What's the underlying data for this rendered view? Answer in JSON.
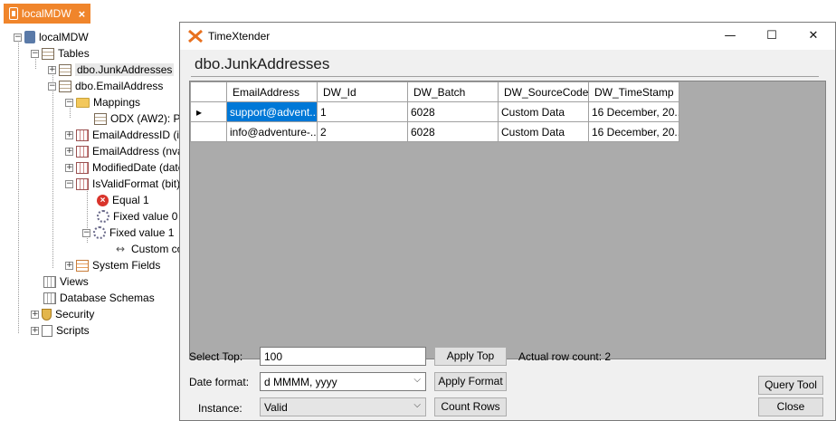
{
  "doc_tab": {
    "label": "localMDW"
  },
  "tree": {
    "root": "localMDW",
    "tables": "Tables",
    "junk": "dbo.JunkAddresses",
    "email": "dbo.EmailAddress",
    "mappings": "Mappings",
    "odx": "ODX (AW2): Pe",
    "f_id": "EmailAddressID (int",
    "f_email": "EmailAddress (nvar",
    "f_mod": "ModifiedDate (datet",
    "f_valid": "IsValidFormat (bit)",
    "equal": "Equal 1",
    "fixed0": "Fixed value 0",
    "fixed1": "Fixed value 1",
    "custom": "Custom cor",
    "sysfields": "System Fields",
    "views": "Views",
    "schemas": "Database Schemas",
    "security": "Security",
    "scripts": "Scripts"
  },
  "dialog": {
    "title": "TimeXtender",
    "heading": "dbo.JunkAddresses",
    "minimize": "—",
    "maximize": "☐",
    "close": "✕"
  },
  "grid": {
    "columns": [
      "EmailAddress",
      "DW_Id",
      "DW_Batch",
      "DW_SourceCode",
      "DW_TimeStamp"
    ],
    "rows": [
      {
        "marker": "▸",
        "cells": [
          "support@advent...",
          "1",
          "6028",
          "Custom Data",
          "16 December, 20..."
        ]
      },
      {
        "marker": "",
        "cells": [
          "info@adventure-...",
          "2",
          "6028",
          "Custom Data",
          "16 December, 20..."
        ]
      }
    ]
  },
  "controls": {
    "select_top_label": "Select Top:",
    "select_top_value": "100",
    "apply_top": "Apply Top",
    "row_count": "Actual row count: 2",
    "date_format_label": "Date format:",
    "date_format_value": "d MMMM, yyyy",
    "apply_format": "Apply Format",
    "instance_label": "Instance:",
    "instance_value": "Valid",
    "count_rows": "Count Rows",
    "query_tool": "Query Tool",
    "close": "Close"
  },
  "colors": {
    "accent": "#f0852b",
    "selection": "#0078d7"
  }
}
